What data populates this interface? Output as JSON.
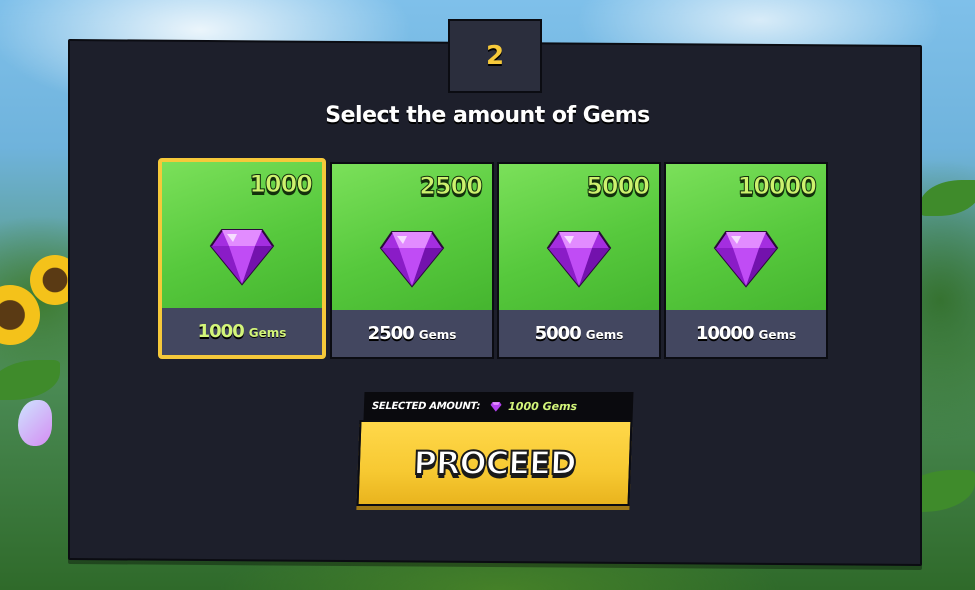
{
  "step": {
    "number": "2"
  },
  "title": "Select the amount of Gems",
  "packages": [
    {
      "amount": "1000",
      "label_amount": "1000",
      "label_unit": "Gems",
      "selected": true
    },
    {
      "amount": "2500",
      "label_amount": "2500",
      "label_unit": "Gems",
      "selected": false
    },
    {
      "amount": "5000",
      "label_amount": "5000",
      "label_unit": "Gems",
      "selected": false
    },
    {
      "amount": "10000",
      "label_amount": "10000",
      "label_unit": "Gems",
      "selected": false
    }
  ],
  "selection": {
    "label": "SELECTED AMOUNT:",
    "icon": "gem-icon",
    "value": "1000 Gems"
  },
  "proceed_label": "PROCEED",
  "colors": {
    "panel": "#1d1f2b",
    "card_green": "#57c93d",
    "card_footer": "#434760",
    "accent_yellow": "#f6c93a",
    "gem_purple": "#b340f0",
    "selected_text": "#d3f57a"
  }
}
